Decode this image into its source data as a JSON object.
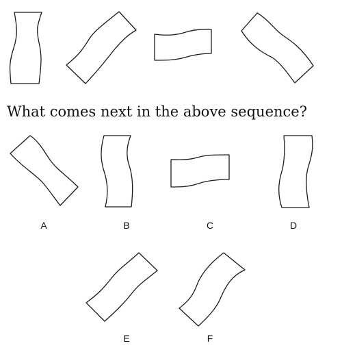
{
  "question": "What comes next in the above sequence?",
  "sequence": [
    {
      "name": "sequence-shape-1"
    },
    {
      "name": "sequence-shape-2"
    },
    {
      "name": "sequence-shape-3"
    },
    {
      "name": "sequence-shape-4"
    }
  ],
  "options": [
    {
      "label": "A"
    },
    {
      "label": "B"
    },
    {
      "label": "C"
    },
    {
      "label": "D"
    },
    {
      "label": "E"
    },
    {
      "label": "F"
    }
  ],
  "colors": {
    "stroke": "#1a1a1a",
    "fill": "#ffffff",
    "text": "#111111"
  }
}
